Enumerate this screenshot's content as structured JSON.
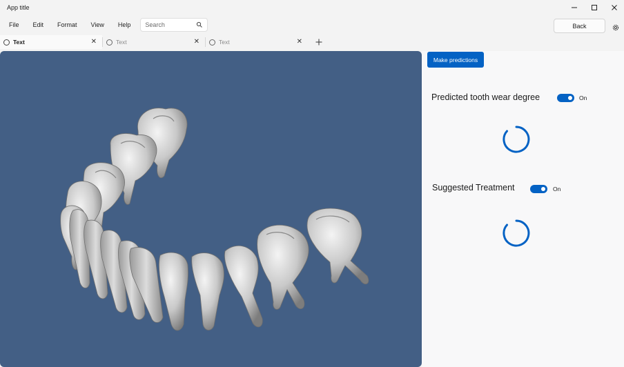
{
  "window": {
    "title": "App title",
    "controls": {
      "minimize": "—",
      "maximize": "☐",
      "close": "✕"
    }
  },
  "menu": {
    "items": [
      "File",
      "Edit",
      "Format",
      "View",
      "Help"
    ],
    "search": {
      "placeholder": "Search",
      "value": ""
    }
  },
  "header": {
    "back_label": "Back"
  },
  "tabs": [
    {
      "label": "Text",
      "active": true
    },
    {
      "label": "Text",
      "active": false
    },
    {
      "label": "Text",
      "active": false
    }
  ],
  "panel": {
    "predict_button": "Make predictions",
    "wear": {
      "label": "Predicted tooth wear degree",
      "toggle_text": "On",
      "toggle_on": true
    },
    "treatment": {
      "label": "Suggested Treatment",
      "toggle_text": "On",
      "toggle_on": true
    }
  },
  "colors": {
    "accent": "#0462c4",
    "viewport_bg": "#435f85",
    "tooth": "#cfcfcf"
  }
}
